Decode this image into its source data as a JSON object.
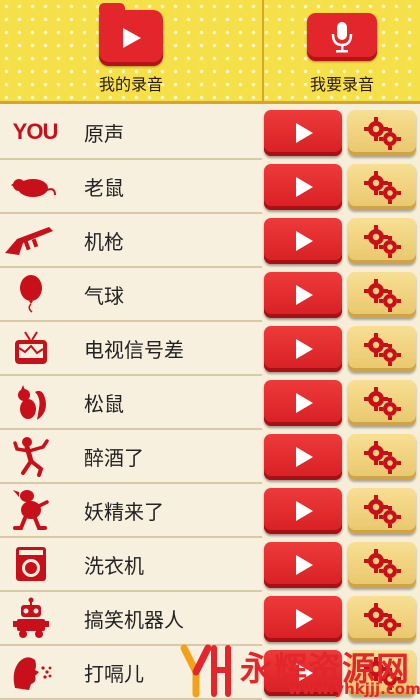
{
  "header": {
    "my_recordings_label": "我的录音",
    "record_label": "我要录音"
  },
  "effects": [
    {
      "label": "原声",
      "icon": "you-text-icon"
    },
    {
      "label": "老鼠",
      "icon": "mouse-icon"
    },
    {
      "label": "机枪",
      "icon": "machine-gun-icon"
    },
    {
      "label": "气球",
      "icon": "balloon-icon"
    },
    {
      "label": "电视信号差",
      "icon": "tv-icon"
    },
    {
      "label": "松鼠",
      "icon": "squirrel-icon"
    },
    {
      "label": "醉酒了",
      "icon": "drunk-person-icon"
    },
    {
      "label": "妖精来了",
      "icon": "goblin-icon"
    },
    {
      "label": "洗衣机",
      "icon": "washing-machine-icon"
    },
    {
      "label": "搞笑机器人",
      "icon": "robot-icon"
    },
    {
      "label": "打嗝儿",
      "icon": "hiccup-head-icon"
    }
  ],
  "you_icon_text": "YOU",
  "watermark": {
    "text": "永辉资源网",
    "url": "www.yhkjjj.com"
  },
  "colors": {
    "accent_red": "#e3262b",
    "header_yellow": "#f6e04a",
    "gear_yellow": "#f0d27e"
  }
}
